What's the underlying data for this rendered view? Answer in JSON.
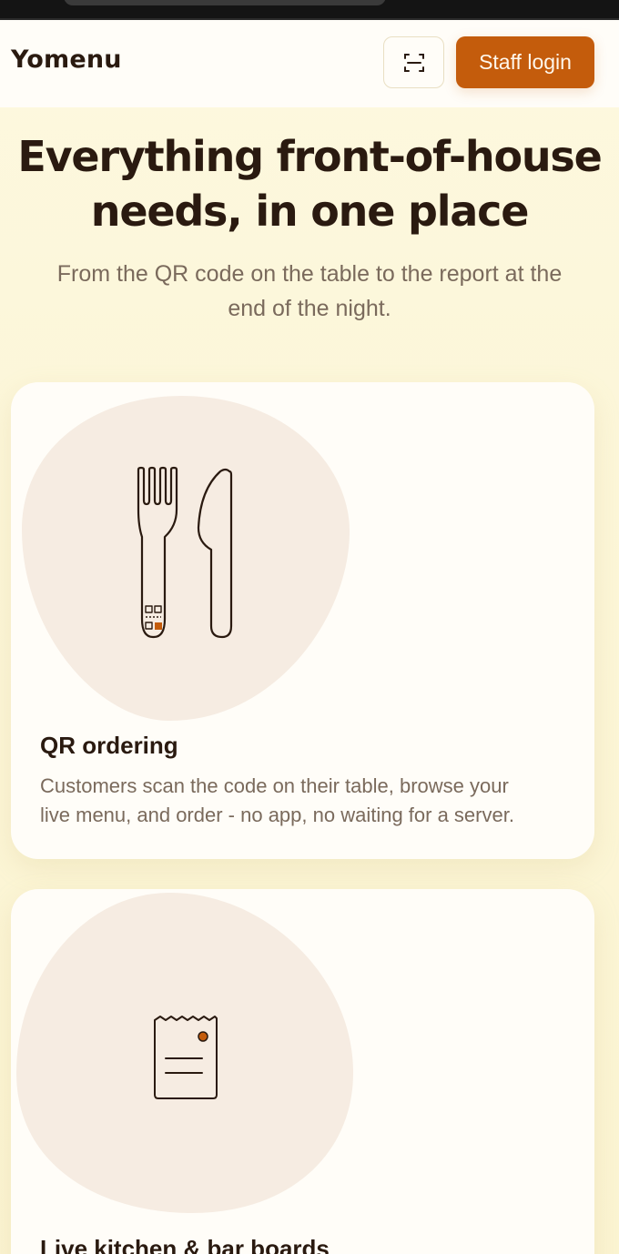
{
  "header": {
    "logo": "Yomenu",
    "scan_icon": "qr-scan-icon",
    "staff_login_label": "Staff login"
  },
  "hero": {
    "title_line1": "Everything front-of-house",
    "title_line2": "needs, in one place",
    "subtitle_line1": "From the QR code on the table to the report at the",
    "subtitle_line2": "end of the night."
  },
  "features": [
    {
      "icon": "fork-knife-qr-icon",
      "title": "QR ordering",
      "description_line1": "Customers scan the code on their table, browse your",
      "description_line2": "live menu, and order - no app, no waiting for a server."
    },
    {
      "icon": "ticket-icon",
      "title": "Live kitchen & bar boards"
    }
  ],
  "colors": {
    "accent": "#c45c0c",
    "background": "#fdf7dc",
    "card": "#fffdf8",
    "blob": "#f6ece2",
    "text_dark": "#2a1a10",
    "text_muted": "#7a6a5c"
  }
}
